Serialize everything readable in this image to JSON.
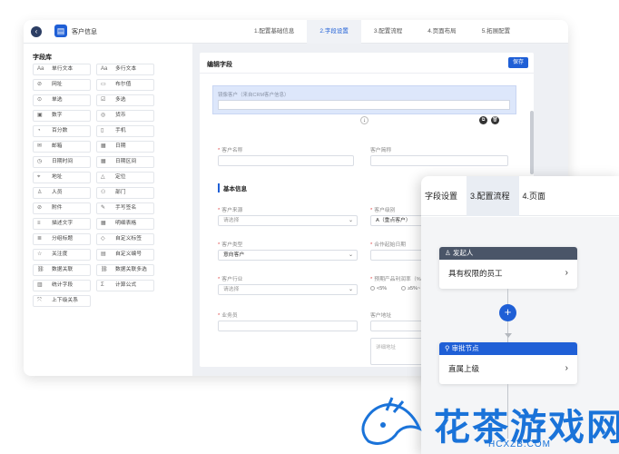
{
  "header": {
    "app_title": "客户信息",
    "steps": [
      "1.配置基础信息",
      "2.字段设置",
      "3.配置流程",
      "4.页面布局",
      "5.拓展配置"
    ],
    "active_step": 1
  },
  "library": {
    "title": "字段库",
    "items": [
      {
        "label": "单行文本",
        "icon": "Aa"
      },
      {
        "label": "多行文本",
        "icon": "Aa"
      },
      {
        "label": "网址",
        "icon": "⊘"
      },
      {
        "label": "布尔值",
        "icon": "▭"
      },
      {
        "label": "单选",
        "icon": "⊙"
      },
      {
        "label": "多选",
        "icon": "☑"
      },
      {
        "label": "数字",
        "icon": "▣"
      },
      {
        "label": "货币",
        "icon": "◎"
      },
      {
        "label": "百分数",
        "icon": "◔"
      },
      {
        "label": "手机",
        "icon": "▯"
      },
      {
        "label": "邮箱",
        "icon": "✉"
      },
      {
        "label": "日期",
        "icon": "▦"
      },
      {
        "label": "日期时间",
        "icon": "◷"
      },
      {
        "label": "日期区间",
        "icon": "▦"
      },
      {
        "label": "地址",
        "icon": "⌖"
      },
      {
        "label": "定位",
        "icon": "△"
      },
      {
        "label": "人员",
        "icon": "♙"
      },
      {
        "label": "部门",
        "icon": "⚇"
      },
      {
        "label": "附件",
        "icon": "⊘"
      },
      {
        "label": "手写签名",
        "icon": "✎"
      },
      {
        "label": "描述文字",
        "icon": "≡"
      },
      {
        "label": "明细表格",
        "icon": "▦"
      },
      {
        "label": "分组标题",
        "icon": "≣"
      },
      {
        "label": "自定义标签",
        "icon": "◇"
      },
      {
        "label": "关注度",
        "icon": "☆"
      },
      {
        "label": "自定义编号",
        "icon": "▤"
      },
      {
        "label": "数据关联",
        "icon": "⛓"
      },
      {
        "label": "数据关联多选",
        "icon": "⛓"
      },
      {
        "label": "统计字段",
        "icon": "▥"
      },
      {
        "label": "计算公式",
        "icon": "Σ"
      },
      {
        "label": "上下级关系",
        "icon": "⤧"
      }
    ]
  },
  "editor": {
    "title": "编辑字段",
    "save_label": "保存",
    "mirror_label": "镜像客户（来自CRM客户信息）",
    "fields": {
      "customer_name": "客户名称",
      "customer_short": "客户简称",
      "section_basic": "基本信息",
      "source": "客户来源",
      "source_placeholder": "请选择",
      "level": "客户级别",
      "level_value": "A（重点客户）",
      "type": "客户类型",
      "type_value": "意向客户",
      "start_date": "合作起始日期",
      "industry": "客户行业",
      "industry_placeholder": "请选择",
      "rate": "预期产品利润率（%",
      "rate_opt1": "<5%",
      "rate_opt2": "≥5%~",
      "salesman": "业务员",
      "address": "客户地址",
      "address_placeholder": "详细地址"
    }
  },
  "flow": {
    "tabs": [
      "字段设置",
      "3.配置流程",
      "4.页面"
    ],
    "start_node": {
      "title": "发起人",
      "body": "具有权限的员工"
    },
    "approve_node": {
      "title": "审批节点",
      "body": "直属上级"
    }
  },
  "watermark": {
    "text": "花茶游戏网",
    "sub": "HCXZB.COM"
  }
}
